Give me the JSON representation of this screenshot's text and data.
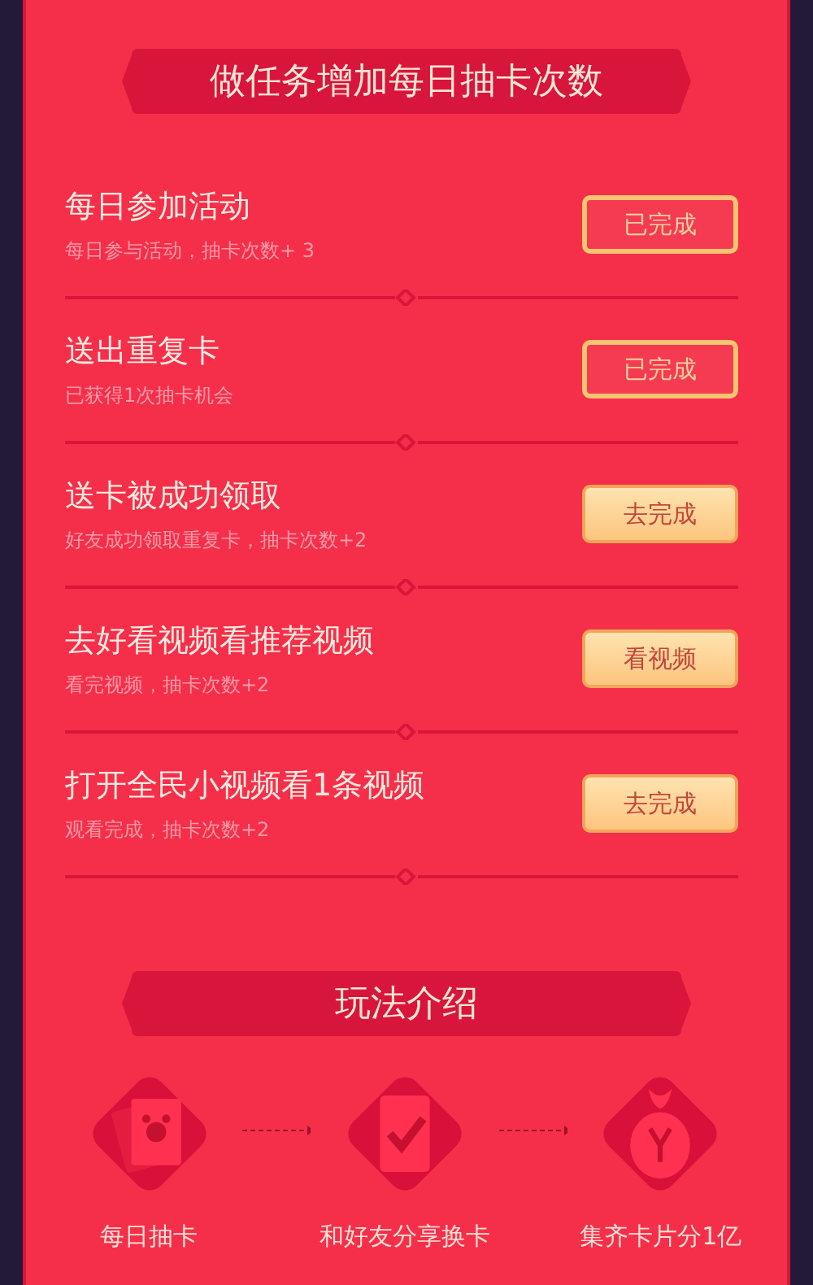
{
  "tasks_section": {
    "title": "做任务增加每日抽卡次数",
    "tasks": [
      {
        "title": "每日参加活动",
        "subtitle": "每日参与活动，抽卡次数+ 3",
        "button": "已完成",
        "completed": true
      },
      {
        "title": "送出重复卡",
        "subtitle": "已获得1次抽卡机会",
        "button": "已完成",
        "completed": true
      },
      {
        "title": "送卡被成功领取",
        "subtitle": "好友成功领取重复卡，抽卡次数+2",
        "button": "去完成",
        "completed": false
      },
      {
        "title": "去好看视频看推荐视频",
        "subtitle": "看完视频，抽卡次数+2",
        "button": "看视频",
        "completed": false
      },
      {
        "title": "打开全民小视频看1条视频",
        "subtitle": "观看完成，抽卡次数+2",
        "button": "去完成",
        "completed": false
      }
    ]
  },
  "rules_section": {
    "title": "玩法介绍",
    "steps": [
      {
        "kind": "cards",
        "label": "每日抽卡"
      },
      {
        "kind": "check",
        "label": "和好友分享换卡"
      },
      {
        "kind": "bag",
        "label": "集齐卡片分1亿"
      }
    ]
  }
}
